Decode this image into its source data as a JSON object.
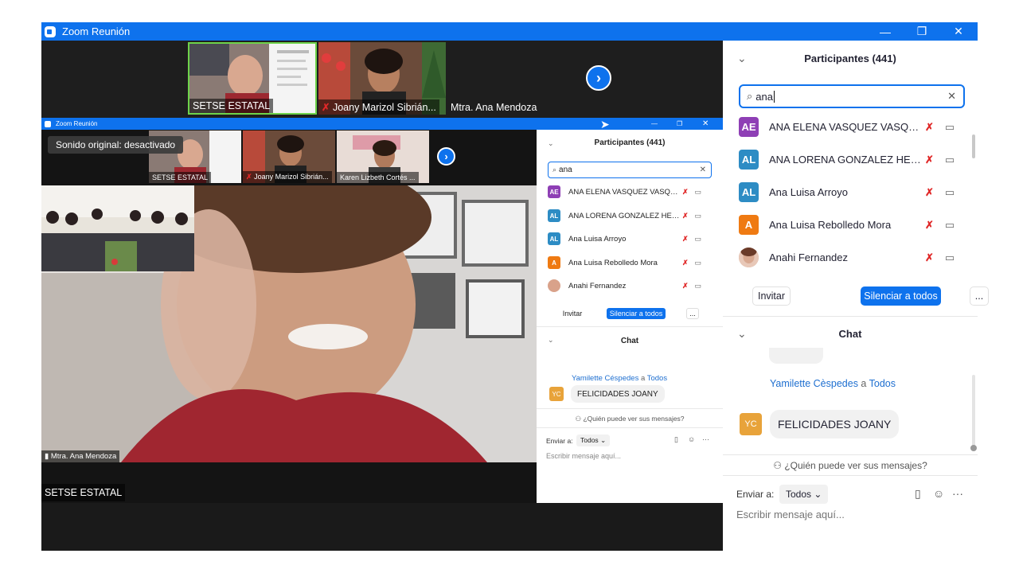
{
  "window": {
    "title": "Zoom Reunión",
    "minimize": "—",
    "restore": "❐",
    "close": "✕"
  },
  "strip": {
    "thumbs": [
      {
        "name": "SETSE ESTATAL",
        "muted": false
      },
      {
        "name": "Joany Marizol Sibrián...",
        "muted": true
      },
      {
        "name": "Mtra. Ana Mendoza",
        "muted": false
      }
    ],
    "next_icon": "chevron-right-icon"
  },
  "nested": {
    "title": "Zoom Reunión",
    "sonido": "Sonido original: desactivado",
    "thumbs": [
      {
        "name": "SETSE ESTATAL"
      },
      {
        "name": "Joany Marizol Sibrián..."
      },
      {
        "name": "Karen Lizbeth Cortés ..."
      }
    ],
    "active_speaker": "Mtra. Ana Mendoza",
    "participants_title": "Participantes (441)",
    "search_value": "ana",
    "participants": [
      {
        "initials": "AE",
        "name": "ANA ELENA VASQUEZ VASQUEZ",
        "color": "#8e3fb5"
      },
      {
        "initials": "AL",
        "name": "ANA LORENA GONZALEZ HERN...",
        "color": "#2d8cc4"
      },
      {
        "initials": "AL",
        "name": "Ana Luisa Arroyo",
        "color": "#2d8cc4"
      },
      {
        "initials": "A",
        "name": "Ana Luisa Rebolledo Mora",
        "color": "#ef7a12"
      },
      {
        "initials": "",
        "name": "Anahi Fernandez",
        "color": "#d9a28a"
      }
    ],
    "invite": "Invitar",
    "mute_all": "Silenciar a todos",
    "more": "...",
    "chat_title": "Chat",
    "chat_sender": "Yamilette Céspedes",
    "chat_to": "a",
    "chat_target": "Todos",
    "chat_initials": "YC",
    "chat_message": "FELICIDADES JOANY",
    "who_can_see": "¿Quién puede ver sus mensajes?",
    "send_to": "Enviar a:",
    "send_target": "Todos",
    "input_placeholder": "Escribir mensaje aquí..."
  },
  "bottom_label": "SETSE ESTATAL",
  "side": {
    "participants_title": "Participantes (441)",
    "search_value": "ana",
    "participants": [
      {
        "initials": "AE",
        "name": "ANA ELENA VASQUEZ VASQUEZ",
        "color": "#8e3fb5"
      },
      {
        "initials": "AL",
        "name": "ANA LORENA GONZALEZ HERN...",
        "color": "#2d8cc4"
      },
      {
        "initials": "AL",
        "name": "Ana Luisa Arroyo",
        "color": "#2d8cc4"
      },
      {
        "initials": "A",
        "name": "Ana Luisa Rebolledo Mora",
        "color": "#ef7a12"
      },
      {
        "initials": "",
        "name": "Anahi Fernandez",
        "color": "#d9a28a"
      }
    ],
    "invite": "Invitar",
    "mute_all": "Silenciar a todos",
    "more": "...",
    "chat_title": "Chat",
    "chat_sender": "Yamilette Cèspedes",
    "chat_to": "a",
    "chat_target": "Todos",
    "chat_initials": "YC",
    "chat_message": "FELICIDADES JOANY",
    "who_can_see": "¿Quién puede ver sus mensajes?",
    "send_to": "Enviar a:",
    "send_target": "Todos",
    "input_placeholder": "Escribir mensaje aquí..."
  },
  "colors": {
    "zoom_blue": "#0e72ed",
    "mute_red": "#e02828",
    "chat_avatar": "#e8a33a"
  }
}
